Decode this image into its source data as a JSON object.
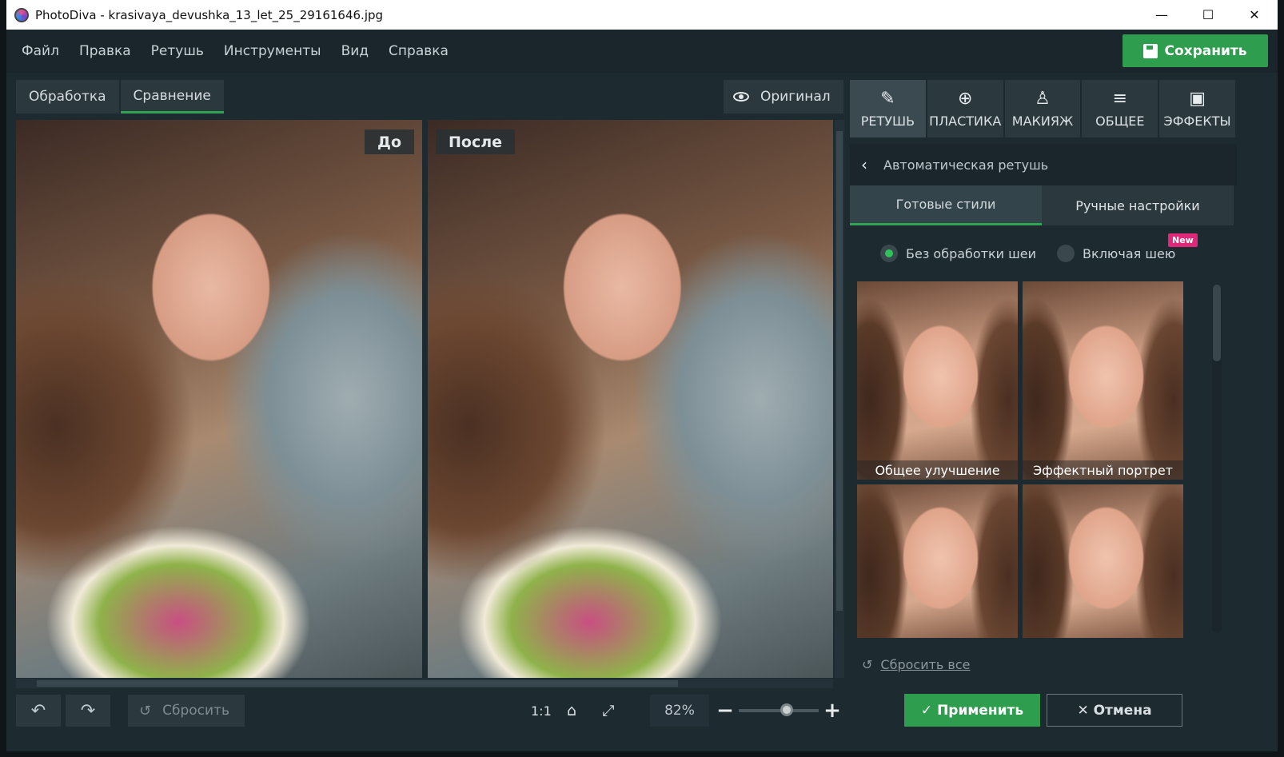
{
  "window": {
    "title": "PhotoDiva - krasivaya_devushka_13_let_25_29161646.jpg",
    "controls": [
      "—",
      "☐",
      "✕"
    ]
  },
  "menu": [
    "Файл",
    "Правка",
    "Ретушь",
    "Инструменты",
    "Вид",
    "Справка"
  ],
  "save_button": "Сохранить",
  "view_tabs": {
    "processing": "Обработка",
    "compare": "Сравнение"
  },
  "original_button": "Оригинал",
  "compare": {
    "before": "До",
    "after": "После"
  },
  "categories": [
    {
      "label": "РЕТУШЬ",
      "icon": "✎"
    },
    {
      "label": "ПЛАСТИКА",
      "icon": "⊕"
    },
    {
      "label": "МАКИЯЖ",
      "icon": "♙"
    },
    {
      "label": "ОБЩЕЕ",
      "icon": "≡"
    },
    {
      "label": "ЭФФЕКТЫ",
      "icon": "▣"
    }
  ],
  "subpanel": {
    "back": "‹",
    "title": "Автоматическая ретушь"
  },
  "style_tabs": {
    "ready": "Готовые стили",
    "manual": "Ручные настройки"
  },
  "radios": {
    "no_neck": "Без обработки шеи",
    "with_neck": "Включая шею",
    "new_badge": "New"
  },
  "presets": [
    {
      "label": "Общее улучшение"
    },
    {
      "label": "Эффектный портрет"
    },
    {
      "label": ""
    },
    {
      "label": ""
    }
  ],
  "reset_all": "Сбросить все",
  "bottom": {
    "undo": "↶",
    "redo": "↷",
    "reset": "Сбросить",
    "one_to_one": "1:1",
    "zoom": "82%",
    "zoom_fraction": 0.6
  },
  "apply_button": "✓ Применить",
  "cancel_button": "✕ Отмена",
  "accent_color": "#2e9d4e"
}
